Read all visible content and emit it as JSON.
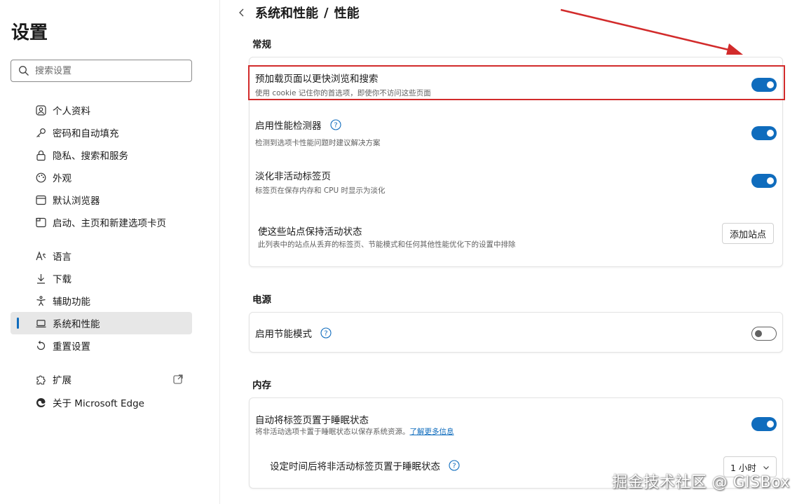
{
  "sidebar": {
    "title": "设置",
    "search_placeholder": "搜索设置",
    "items": [
      {
        "label": "个人资料",
        "icon": "profile-icon"
      },
      {
        "label": "密码和自动填充",
        "icon": "key-icon"
      },
      {
        "label": "隐私、搜索和服务",
        "icon": "lock-icon"
      },
      {
        "label": "外观",
        "icon": "palette-icon"
      },
      {
        "label": "默认浏览器",
        "icon": "browser-icon"
      },
      {
        "label": "启动、主页和新建选项卡页",
        "icon": "home-tabs-icon"
      },
      {
        "label": "语言",
        "icon": "language-icon"
      },
      {
        "label": "下载",
        "icon": "download-icon"
      },
      {
        "label": "辅助功能",
        "icon": "accessibility-icon"
      },
      {
        "label": "系统和性能",
        "icon": "laptop-icon",
        "active": true
      },
      {
        "label": "重置设置",
        "icon": "reset-icon"
      },
      {
        "label": "扩展",
        "icon": "puzzle-icon"
      },
      {
        "label": "关于 Microsoft Edge",
        "icon": "edge-icon"
      }
    ]
  },
  "header": {
    "crumb_parent": "系统和性能",
    "crumb_sep": "/",
    "crumb_current": "性能"
  },
  "sections": {
    "general": {
      "title": "常规",
      "preload": {
        "title": "预加载页面以更快浏览和搜索",
        "desc": "使用 cookie 记住你的首选项，即使你不访问这些页面",
        "enabled": true
      },
      "perf_detector": {
        "title": "启用性能检测器",
        "desc": "检测到选项卡性能问题时建议解决方案",
        "enabled": true
      },
      "fade_tabs": {
        "title": "淡化非活动标签页",
        "desc": "标签页在保存内存和 CPU 时显示为淡化",
        "enabled": true
      },
      "keep_active": {
        "title": "使这些站点保持活动状态",
        "desc": "此列表中的站点从丢弃的标签页、节能模式和任何其他性能优化下的设置中排除",
        "button": "添加站点"
      }
    },
    "power": {
      "title": "电源",
      "efficiency": {
        "title": "启用节能模式",
        "enabled": false
      }
    },
    "memory": {
      "title": "内存",
      "sleep_tabs": {
        "title": "自动将标签页置于睡眠状态",
        "desc": "将非活动选项卡置于睡眠状态以保存系统资源。",
        "link": "了解更多信息",
        "enabled": true
      },
      "sleep_timeout": {
        "title": "设定时间后将非活动标签页置于睡眠状态",
        "value": "1 小时"
      }
    }
  },
  "watermark": "掘金技术社区 @ GISBox",
  "colors": {
    "accent": "#0f6cbd",
    "highlight": "#d22b2b"
  }
}
